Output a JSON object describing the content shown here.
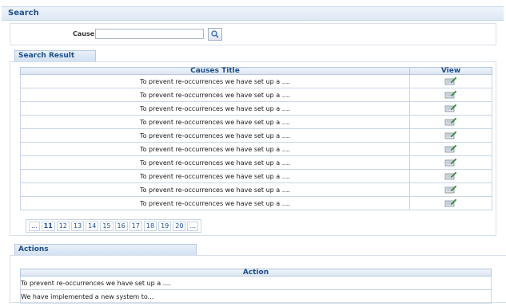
{
  "search_header": {
    "title": "Search"
  },
  "search": {
    "cause_label": "Cause :",
    "cause_value": "",
    "button_icon": "search-icon"
  },
  "search_result": {
    "title": "Search Result",
    "columns": [
      "Causes Title",
      "View"
    ],
    "rows": [
      "To prevent re-occurrences we have set up a ....",
      "To prevent re-occurrences we have set up a ....",
      "To prevent re-occurrences we have set up a ....",
      "To prevent re-occurrences we have set up a ....",
      "To prevent re-occurrences we have set up a ....",
      "To prevent re-occurrences we have set up a ....",
      "To prevent re-occurrences we have set up a ....",
      "To prevent re-occurrences we have set up a ....",
      "To prevent re-occurrences we have set up a ....",
      "To prevent re-occurrences we have set up a ...."
    ],
    "view_icon": "view-icon"
  },
  "pager": {
    "prev": "...",
    "pages": [
      "11",
      "12",
      "13",
      "14",
      "15",
      "16",
      "17",
      "18",
      "19",
      "20"
    ],
    "next": "..."
  },
  "actions": {
    "title": "Actions",
    "column": "Action",
    "rows": [
      "To prevent re-occurrences we have set up a ....",
      "We have implemented a new system to..."
    ]
  }
}
